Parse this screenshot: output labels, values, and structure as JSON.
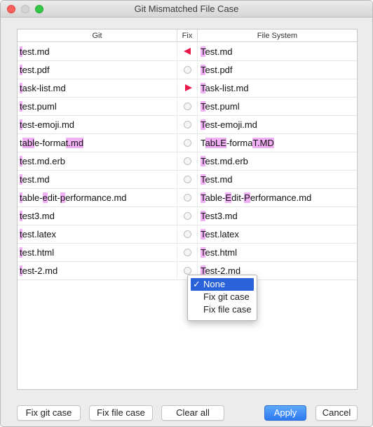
{
  "window": {
    "title": "Git Mismatched File Case"
  },
  "table": {
    "headers": {
      "git": "Git",
      "fix": "Fix",
      "fs": "File System"
    },
    "rows": [
      {
        "git": [
          [
            "t",
            true
          ],
          [
            "est.md",
            false
          ]
        ],
        "fix": "left",
        "fs": [
          [
            "T",
            true
          ],
          [
            "est.md",
            false
          ]
        ]
      },
      {
        "git": [
          [
            "t",
            true
          ],
          [
            "est.pdf",
            false
          ]
        ],
        "fix": "none",
        "fs": [
          [
            "T",
            true
          ],
          [
            "est.pdf",
            false
          ]
        ]
      },
      {
        "git": [
          [
            "t",
            true
          ],
          [
            "ask-list.md",
            false
          ]
        ],
        "fix": "right",
        "fs": [
          [
            "T",
            true
          ],
          [
            "ask-list.md",
            false
          ]
        ]
      },
      {
        "git": [
          [
            "t",
            true
          ],
          [
            "est.puml",
            false
          ]
        ],
        "fix": "none",
        "fs": [
          [
            "T",
            true
          ],
          [
            "est.puml",
            false
          ]
        ]
      },
      {
        "git": [
          [
            "t",
            true
          ],
          [
            "est-emoji.md",
            false
          ]
        ],
        "fix": "none",
        "fs": [
          [
            "T",
            true
          ],
          [
            "est-emoji.md",
            false
          ]
        ]
      },
      {
        "git": [
          [
            "t",
            false
          ],
          [
            "abl",
            true
          ],
          [
            "e-forma",
            false
          ],
          [
            "t.md",
            true
          ]
        ],
        "fix": "none",
        "fs": [
          [
            "T",
            false
          ],
          [
            "abLE",
            true
          ],
          [
            "-forma",
            false
          ],
          [
            "T.MD",
            true
          ]
        ]
      },
      {
        "git": [
          [
            "t",
            true
          ],
          [
            "est.md.erb",
            false
          ]
        ],
        "fix": "none",
        "fs": [
          [
            "T",
            true
          ],
          [
            "est.md.erb",
            false
          ]
        ]
      },
      {
        "git": [
          [
            "t",
            true
          ],
          [
            "est.md",
            false
          ]
        ],
        "fix": "none",
        "fs": [
          [
            "T",
            true
          ],
          [
            "est.md",
            false
          ]
        ]
      },
      {
        "git": [
          [
            "t",
            true
          ],
          [
            "able-",
            false
          ],
          [
            "e",
            true
          ],
          [
            "dit-",
            false
          ],
          [
            "p",
            true
          ],
          [
            "erformance.md",
            false
          ]
        ],
        "fix": "none",
        "fs": [
          [
            "T",
            true
          ],
          [
            "able-",
            false
          ],
          [
            "E",
            true
          ],
          [
            "dit-",
            false
          ],
          [
            "P",
            true
          ],
          [
            "erformance.md",
            false
          ]
        ]
      },
      {
        "git": [
          [
            "t",
            true
          ],
          [
            "est3.md",
            false
          ]
        ],
        "fix": "none",
        "fs": [
          [
            "T",
            true
          ],
          [
            "est3.md",
            false
          ]
        ]
      },
      {
        "git": [
          [
            "t",
            true
          ],
          [
            "est.latex",
            false
          ]
        ],
        "fix": "none",
        "fs": [
          [
            "T",
            true
          ],
          [
            "est.latex",
            false
          ]
        ]
      },
      {
        "git": [
          [
            "t",
            true
          ],
          [
            "est.html",
            false
          ]
        ],
        "fix": "none",
        "fs": [
          [
            "T",
            true
          ],
          [
            "est.html",
            false
          ]
        ]
      },
      {
        "git": [
          [
            "t",
            true
          ],
          [
            "est-2.md",
            false
          ]
        ],
        "fix": "none",
        "fs": [
          [
            "T",
            true
          ],
          [
            "est-2.md",
            false
          ]
        ]
      }
    ]
  },
  "popup_menu": {
    "items": [
      {
        "label": "None",
        "selected": true,
        "check": "✓"
      },
      {
        "label": "Fix git case",
        "selected": false
      },
      {
        "label": "Fix file case",
        "selected": false
      }
    ]
  },
  "buttons": {
    "fix_git_case": "Fix git case",
    "fix_file_case": "Fix file case",
    "clear_all": "Clear all",
    "apply": "Apply",
    "cancel": "Cancel"
  },
  "colors": {
    "highlight": "#f1b0f5",
    "fix_arrow": "#e8194a",
    "menu_selected": "#2a62d9",
    "apply_button": "#2d79f2"
  }
}
